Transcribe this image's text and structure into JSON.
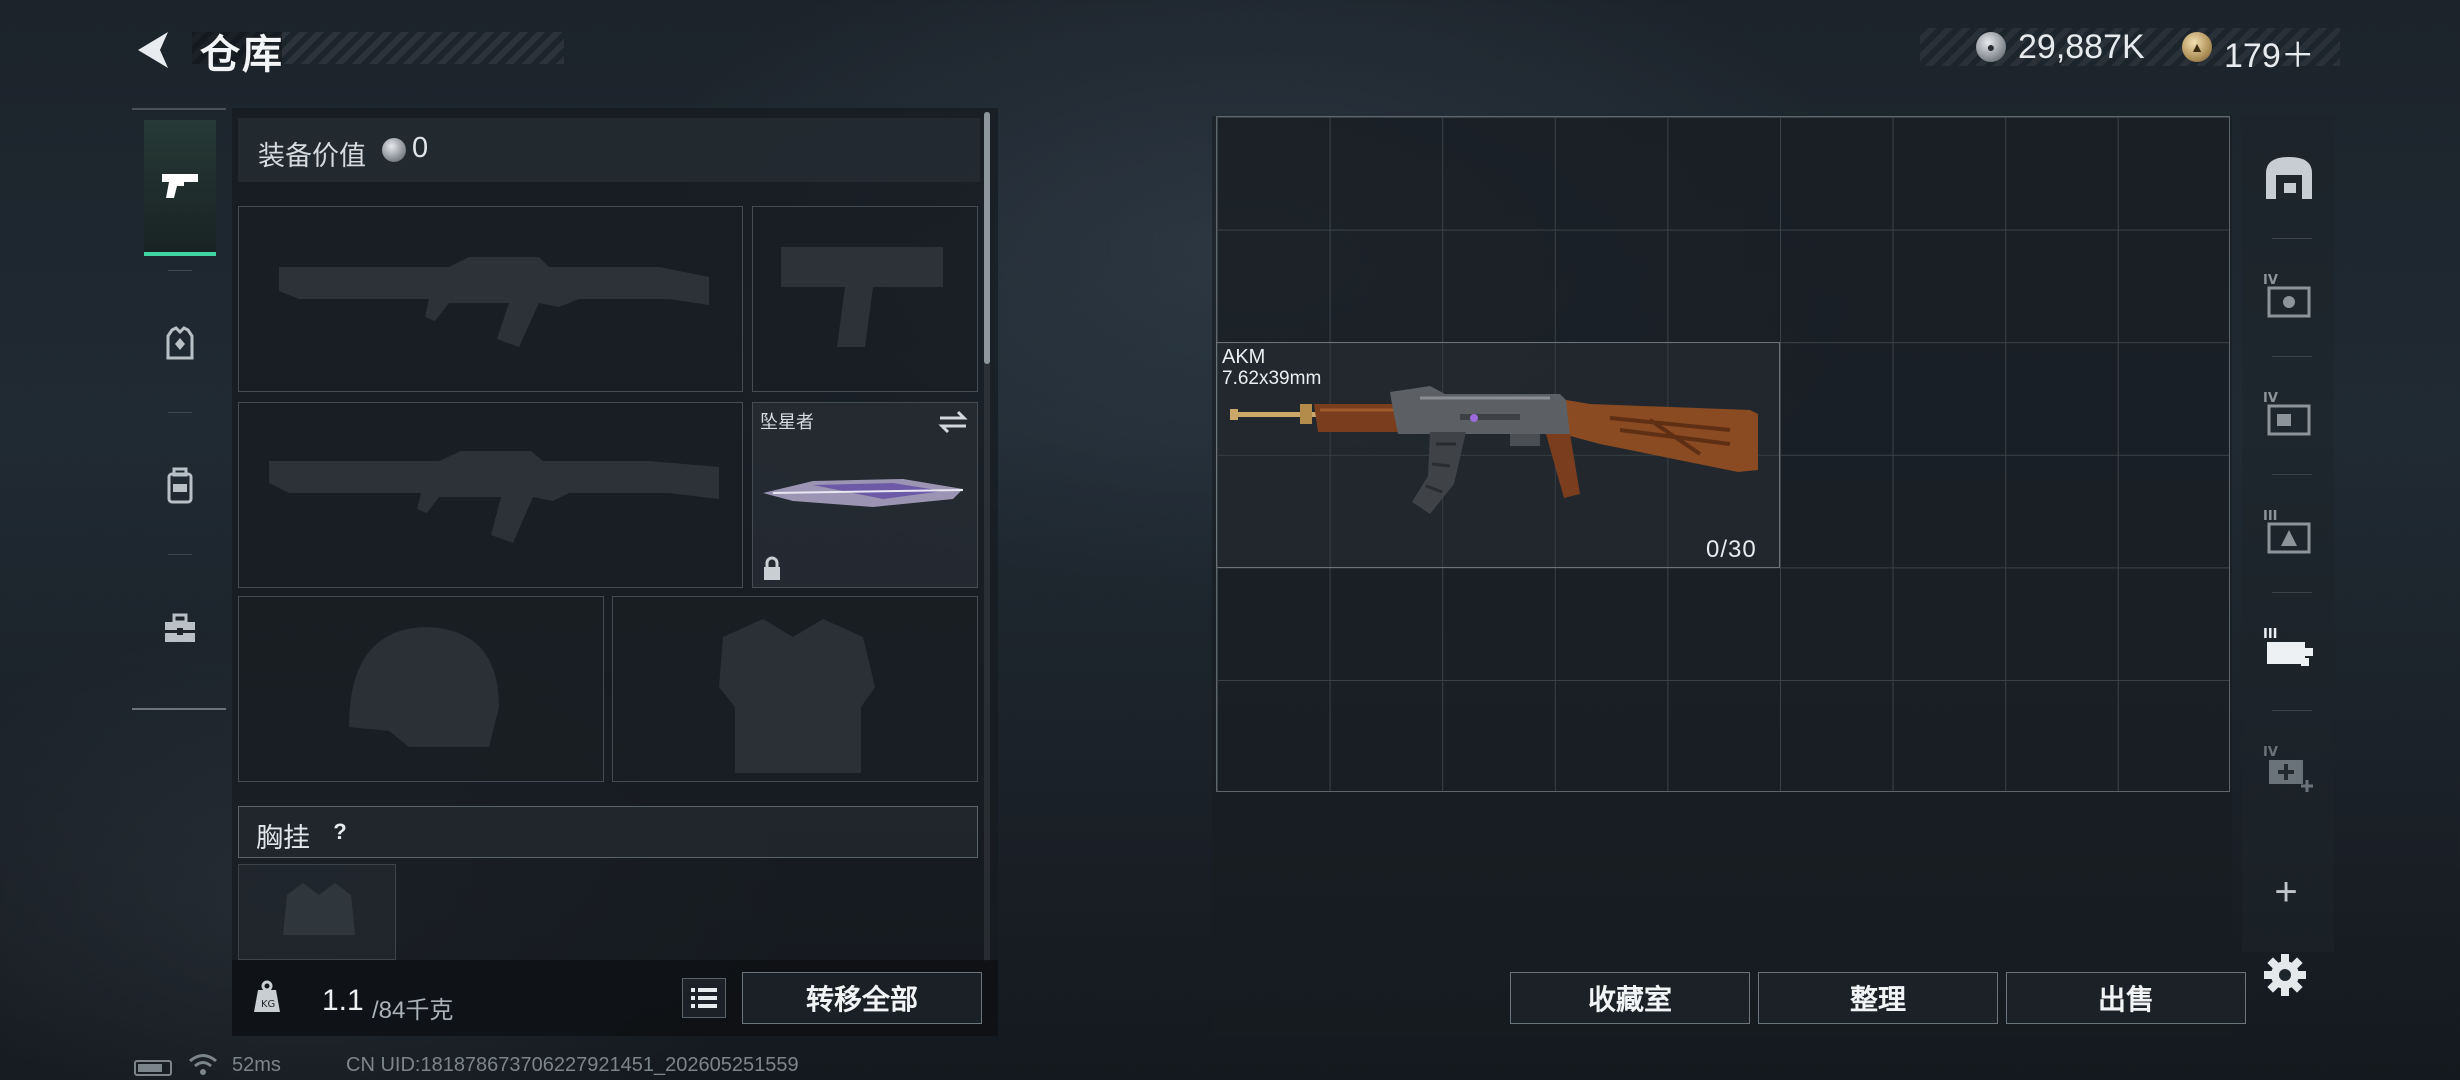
{
  "header": {
    "title": "仓库",
    "currency1_value": "29,887K",
    "currency2_value": "179＋"
  },
  "equipment": {
    "value_label": "装备价值",
    "value": "0",
    "melee_name": "坠星者",
    "chest_label": "胸挂",
    "help_symbol": "?"
  },
  "capacity": {
    "current": "1.1",
    "max": "/84千克"
  },
  "actions": {
    "transfer_all": "转移全部",
    "collection": "收藏室",
    "sort": "整理",
    "sell": "出售"
  },
  "storage": {
    "item": {
      "name": "AKM",
      "caliber": "7.62x39mm",
      "ammo": "0/30"
    }
  },
  "status_bar": {
    "ping": "52ms",
    "uid": "CN UID:181878673706227921451_202605251559"
  },
  "colors": {
    "accent": "#3fd3a0",
    "panel": "#161b20"
  }
}
